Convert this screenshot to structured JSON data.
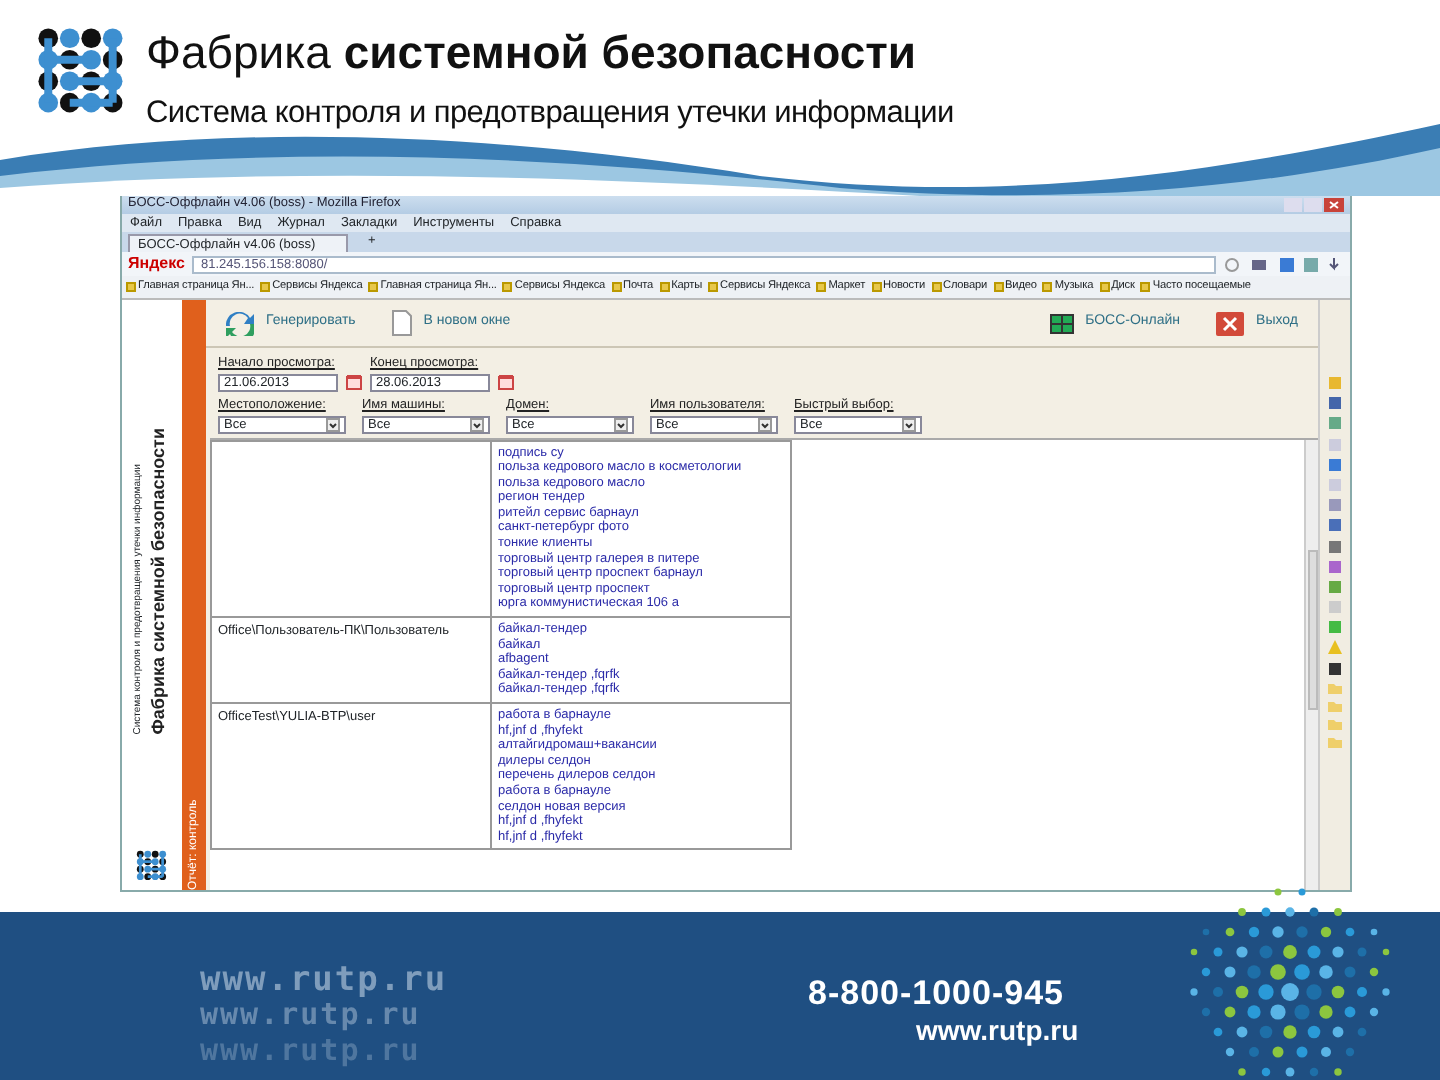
{
  "slide_header": {
    "title_light": "Фабрика",
    "title_bold": "системной безопасности",
    "subtitle": "Система контроля и предотвращения утечки информации"
  },
  "browser": {
    "title": "БОСС-Оффлайн v4.06 (boss) - Mozilla Firefox",
    "menu": [
      "Файл",
      "Правка",
      "Вид",
      "Журнал",
      "Закладки",
      "Инструменты",
      "Справка"
    ],
    "tabs": [
      {
        "label": "БОСС-Оффлайн v4.06 (boss)",
        "selected": true
      }
    ],
    "new_tab": "+",
    "search_logo": "Яндекс",
    "url": "81.245.156.158:8080/",
    "bookmarks": [
      "Главная страница Ян...",
      "Сервисы Яндекса",
      "Главная страница Ян...",
      "Сервисы Яндекса",
      "Почта",
      "Карты",
      "Сервисы Яндекса",
      "Маркет",
      "Новости",
      "Словари",
      "Видео",
      "Музыка",
      "Диск",
      "Часто посещаемые"
    ]
  },
  "app": {
    "side_tab": "Отчёт: контроль",
    "side_logo": {
      "title": "Фабрика системной безопасности",
      "subtitle": "Система контроля и предотвращения утечки информации"
    },
    "toolbar": {
      "left": [
        {
          "kind": "refresh",
          "label": "Генерировать"
        },
        {
          "kind": "page",
          "label": "В новом окне"
        }
      ],
      "right": [
        {
          "kind": "grid",
          "label": "БОСС-Онлайн"
        },
        {
          "kind": "close",
          "label": "Выход"
        }
      ]
    },
    "dates": [
      {
        "label": "Начало просмотра:",
        "value": "21.06.2013"
      },
      {
        "label": "Конец просмотра:",
        "value": "28.06.2013"
      }
    ],
    "filters": [
      {
        "label": "Местоположение:",
        "value": "Все"
      },
      {
        "label": "Имя машины:",
        "value": "Все"
      },
      {
        "label": "Домен:",
        "value": "Все"
      },
      {
        "label": "Имя пользователя:",
        "value": "Все"
      },
      {
        "label": "Быстрый выбор:",
        "value": "Все"
      }
    ],
    "rows": [
      {
        "user": "",
        "queries": [
          "подпись су",
          "польза кедрового масло в косметологии",
          "польза кедрового масло",
          "регион тендер",
          "ритейл сервис барнаул",
          "санкт-петербург фото",
          "тонкие клиенты",
          "торговый центр галерея в питере",
          "торговый центр проспект барнаул",
          "торговый центр проспект",
          "юрга коммунистическая 106 а"
        ]
      },
      {
        "user": "Office\\Пользователь-ПК\\Пользователь",
        "queries": [
          "байкал-тендер",
          "байкал",
          "afbagent",
          "байкал-тендер ,fqrfk",
          "байкал-тендер ,fqrfk"
        ]
      },
      {
        "user": "OfficeTest\\YULIA-BTP\\user",
        "queries": [
          "работа в барнауле",
          "hf,jnf d ,fhyfekt",
          "алтайгидромаш+вакансии",
          "дилеры селдон",
          "перечень дилеров селдон",
          "работа в барнауле",
          "селдон новая версия",
          "hf,jnf d ,fhyfekt",
          "hf,jnf d ,fhyfekt"
        ]
      }
    ]
  },
  "footer": {
    "phone": "8-800-1000-945",
    "site": "www.rutp.ru",
    "decor_sites": [
      "www.rutp.ru",
      "www.rutp.ru",
      "www.rutp.ru"
    ]
  }
}
